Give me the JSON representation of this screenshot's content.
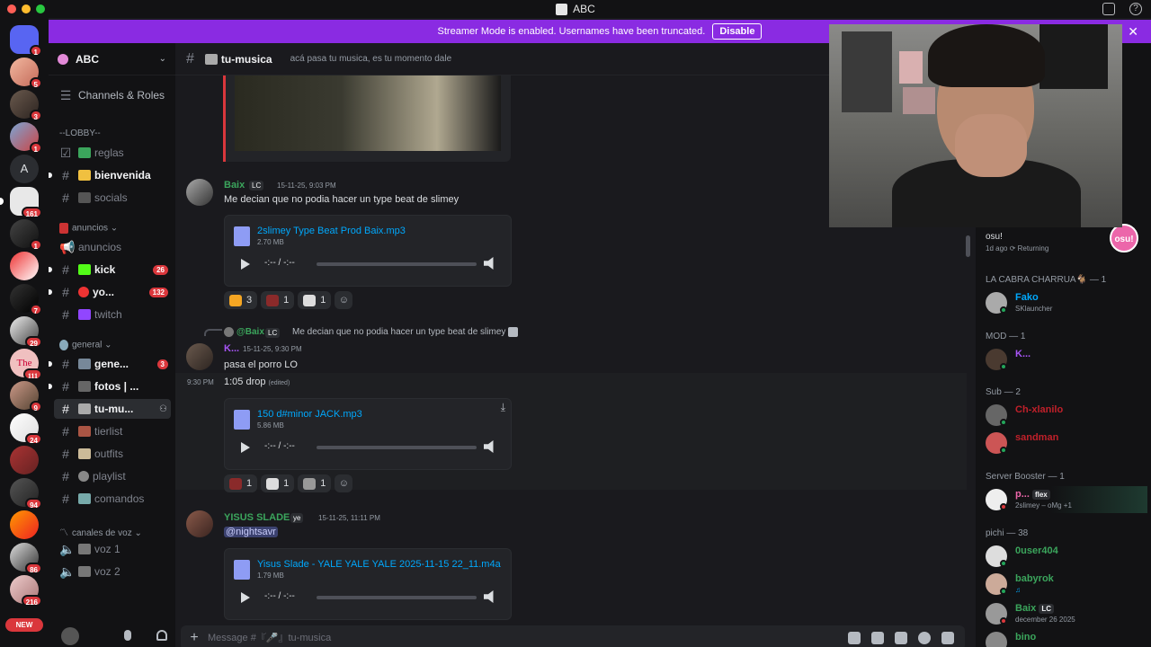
{
  "window": {
    "title": "ABC"
  },
  "banner": {
    "text": "Streamer Mode is enabled. Usernames have been truncated.",
    "disable_label": "Disable",
    "close": "✕"
  },
  "rail": {
    "badges": [
      "1",
      "5",
      "3",
      "1",
      "161",
      "1",
      "7",
      "29",
      "111",
      "9",
      "24",
      "94",
      "86",
      "216"
    ],
    "letter": "A",
    "new_label": "NEW"
  },
  "guild": {
    "name": "ABC"
  },
  "sidebar": {
    "channels_roles": "Channels & Roles",
    "lobby_cat": "--LOBBY--",
    "reglas": "reglas",
    "bienvenida": "bienvenida",
    "socials": "socials",
    "anuncios_cat": "anuncios",
    "anuncios": "anuncios",
    "kick": "kick",
    "kick_badge": "26",
    "yo": "yo...",
    "yo_badge": "132",
    "twitch": "twitch",
    "general_cat": "general",
    "gene": "gene...",
    "gene_badge": "3",
    "fotos": "fotos | ...",
    "tumu": "tu-mu...",
    "tierlist": "tierlist",
    "outfits": "outfits",
    "playlist": "playlist",
    "comandos": "comandos",
    "voz_cat": "canales de voz",
    "voz1": "voz 1",
    "voz2": "voz 2"
  },
  "channel": {
    "name": "tu-musica",
    "topic": "acá pasa tu musica, es tu momento dale"
  },
  "messages": {
    "m1": {
      "author": "Baix",
      "tag": "LC",
      "timestamp": "15-11-25, 9:03 PM",
      "text": "Me decian que no podia hacer un type beat de slimey",
      "file": "2slimey Type Beat Prod Baix.mp3",
      "size": "2.70 MB",
      "time": "-:-- / -:--",
      "reactions": [
        "3",
        "1",
        "1"
      ]
    },
    "m2": {
      "reply_author": "@Baix",
      "reply_tag": "LC",
      "reply_text": "Me decian que no podia hacer un type beat de slimey",
      "author": "K...",
      "timestamp": "15-11-25, 9:30 PM",
      "text": "pasa el porro LO",
      "side_time": "9:30 PM",
      "text2": "1:05 drop",
      "edited": "(edited)",
      "file": "150 d#minor JACK.mp3",
      "size": "5.86 MB",
      "time": "-:-- / -:--",
      "reactions": [
        "1",
        "1",
        "1"
      ]
    },
    "m3": {
      "author": "YISUS SLADE",
      "tag": "ye",
      "timestamp": "15-11-25, 11:11 PM",
      "mention": "@nightsavr",
      "file": "Yisus Slade - YALE YALE YALE 2025-11-15 22_11.m4a",
      "size": "1.79 MB",
      "time": "-:-- / -:--"
    }
  },
  "composer": {
    "placeholder": "Message #『🎤』tu-musica"
  },
  "members": {
    "presence_title": "osu!",
    "presence_sub": "1d ago  ⟳ Returning",
    "osu_badge": "osu!",
    "cat1": "LA CABRA CHARRUA🐐 — 1",
    "fako": "Fako",
    "fako_sub": "SKlauncher",
    "cat2": "MOD — 1",
    "mod1": "K...",
    "cat3": "Sub — 2",
    "sub1": "Ch-xlanilo",
    "sub2": "sandman",
    "cat4": "Server Booster — 1",
    "boost1": "p...",
    "boost1_tag": "flex",
    "boost1_sub": "2slimey – oMg +1",
    "cat5": "pichi — 38",
    "p1": "0user404",
    "p2": "babyrok",
    "p3": "Baix",
    "p3_tag": "LC",
    "p3_sub": "december 26 2025",
    "p4": "bino"
  },
  "colors": {
    "accent": "#5865f2",
    "banner": "#8a2be2",
    "mention": "#da373c",
    "online": "#23a55a",
    "link": "#00a8fc"
  }
}
